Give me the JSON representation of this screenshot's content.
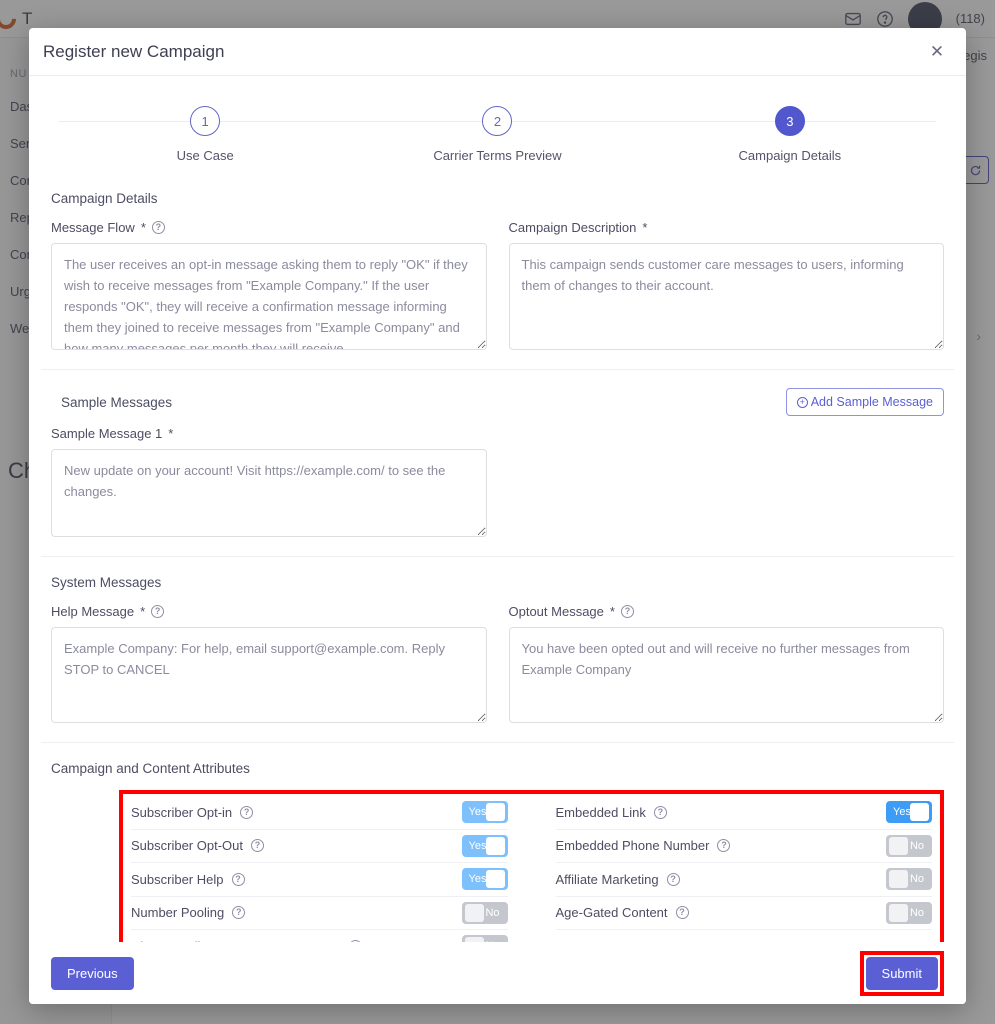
{
  "background": {
    "logo_text": "T",
    "header_count": "(118)",
    "page_label": "Regis",
    "chevron": "›",
    "big_text": "Ch",
    "menu_label": "NU",
    "sidebar_items": [
      {
        "label": "Das"
      },
      {
        "label": "Sen"
      },
      {
        "label": "Con"
      },
      {
        "label": "Rep"
      },
      {
        "label": "Con"
      },
      {
        "label": "Urg"
      },
      {
        "label": "Web"
      }
    ]
  },
  "modal": {
    "title": "Register new Campaign",
    "close_label": "✕"
  },
  "stepper": {
    "steps": [
      {
        "number": "1",
        "label": "Use Case",
        "active": false
      },
      {
        "number": "2",
        "label": "Carrier Terms Preview",
        "active": false
      },
      {
        "number": "3",
        "label": "Campaign Details",
        "active": true
      }
    ]
  },
  "sections": {
    "campaign_details_title": "Campaign Details",
    "sample_messages_title": "Sample Messages",
    "system_messages_title": "System Messages",
    "attributes_title": "Campaign and Content Attributes"
  },
  "fields": {
    "message_flow": {
      "label": "Message Flow",
      "required": "*",
      "value": "The user receives an opt-in message asking them to reply \"OK\" if they wish to receive messages from \"Example Company.\" If the user responds \"OK\", they will receive a confirmation message informing them they joined to receive messages from \"Example Company\" and how many messages per month they will receive."
    },
    "campaign_description": {
      "label": "Campaign Description",
      "required": "*",
      "value": "This campaign sends customer care messages to users, informing them of changes to their account."
    },
    "sample_message_1": {
      "label": "Sample Message 1",
      "required": "*",
      "value": "New update on your account! Visit https://example.com/ to see the changes."
    },
    "help_message": {
      "label": "Help Message",
      "required": "*",
      "value": "Example Company: For help, email support@example.com. Reply STOP to CANCEL"
    },
    "optout_message": {
      "label": "Optout Message",
      "required": "*",
      "value": "You have been opted out and will receive no further messages from Example Company"
    }
  },
  "buttons": {
    "add_sample_message": "Add Sample Message",
    "previous": "Previous",
    "submit": "Submit"
  },
  "attributes": {
    "left": [
      {
        "label": "Subscriber Opt-in",
        "state": "Yes",
        "on": true
      },
      {
        "label": "Subscriber Opt-Out",
        "state": "Yes",
        "on": true
      },
      {
        "label": "Subscriber Help",
        "state": "Yes",
        "on": true
      },
      {
        "label": "Number Pooling",
        "state": "No",
        "on": false
      },
      {
        "label": "Direct Lending or Loan Arrangement",
        "state": "No",
        "on": false
      }
    ],
    "right": [
      {
        "label": "Embedded Link",
        "state": "Yes",
        "on": true,
        "focused": true
      },
      {
        "label": "Embedded Phone Number",
        "state": "No",
        "on": false
      },
      {
        "label": "Affiliate Marketing",
        "state": "No",
        "on": false
      },
      {
        "label": "Age-Gated Content",
        "state": "No",
        "on": false
      }
    ]
  },
  "colors": {
    "accent": "#5a5fd4",
    "toggle_on": "#7ec0fb",
    "toggle_on_focus": "#3d9cf5",
    "toggle_off": "#c5c7cf",
    "annotation": "#ff0000",
    "logo": "#d4591f"
  }
}
